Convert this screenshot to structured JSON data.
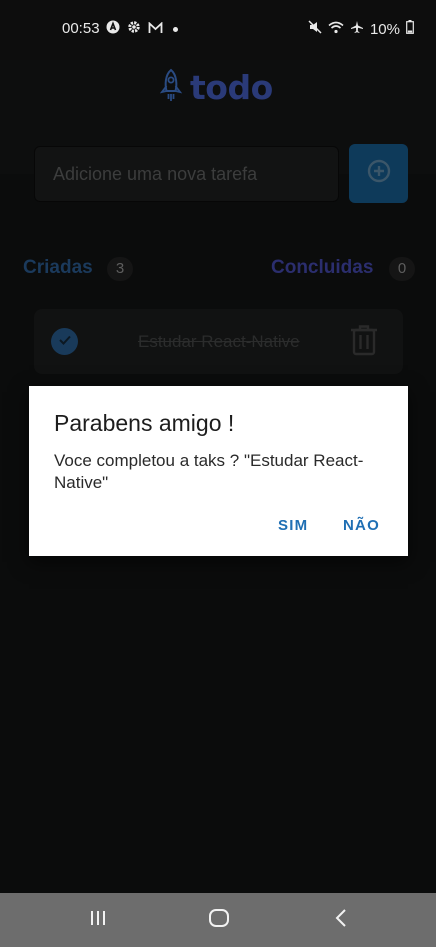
{
  "status_bar": {
    "time": "00:53",
    "battery": "10%",
    "icons_left": [
      "app-a-icon",
      "gear-icon",
      "mail-icon"
    ],
    "icons_right": [
      "mute-icon",
      "wifi-icon",
      "airplane-icon",
      "battery-icon"
    ]
  },
  "header": {
    "logo_text": "todo",
    "logo_icon": "rocket-icon",
    "logo_color": "#2a3a78"
  },
  "new_task": {
    "placeholder": "Adicione uma nova tarefa",
    "value": "",
    "add_icon": "plus-circle-icon"
  },
  "counters": {
    "created_label": "Criadas",
    "created_count": "3",
    "done_label": "Concluidas",
    "done_count": "0"
  },
  "tasks": [
    {
      "title": "Estudar React-Native",
      "completed": true
    }
  ],
  "dialog": {
    "title": "Parabens amigo !",
    "message": "Voce completou  a taks ? \"Estudar React-Native\"",
    "confirm_label": "SIM",
    "cancel_label": "NÃO",
    "button_color": "#1f6fb4"
  },
  "nav_bar": {
    "items": [
      "recent-apps-icon",
      "home-icon",
      "back-icon"
    ]
  }
}
